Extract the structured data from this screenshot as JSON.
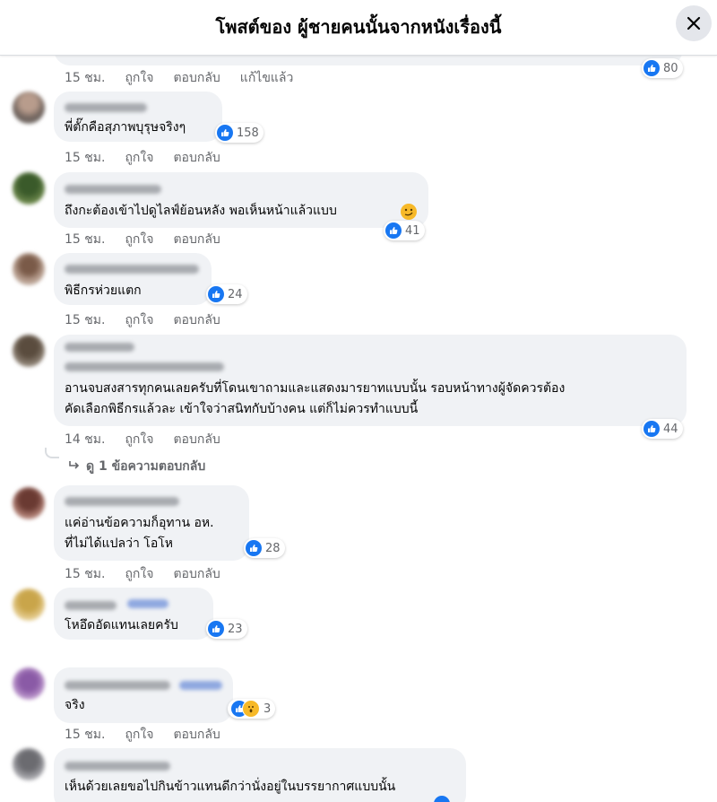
{
  "header": {
    "title": "โพสต์ของ ผู้ชายคนนั้นจากหนังเรื่องนี้"
  },
  "actions": {
    "time_15": "15 ชม.",
    "time_14": "14 ชม.",
    "like": "ถูกใจ",
    "reply": "ตอบกลับ",
    "edited": "แก้ไขแล้ว"
  },
  "comments": [
    {
      "reactions": "80"
    },
    {
      "text": "พี่ตั๊กคือสุภาพบุรุษจริงๆ",
      "reactions": "158"
    },
    {
      "text": "ถึงกะต้องเข้าไปดูไลฟ์ย้อนหลัง พอเห็นหน้าแล้วแบบ",
      "reactions": "41"
    },
    {
      "text": "พิธีกรห่วยแตก",
      "reactions": "24"
    },
    {
      "line1": "อานจบสงสารทุกคนเลยครับที่โดนเขาถามและแสดงมารยาทแบบนั้น รอบหน้าทางผู้จัดควรต้อง",
      "line2": "คัดเลือกพิธีกรแล้วละ เข้าใจว่าสนิทกับบ้างคน แต่ก็ไม่ควรทำแบบนี้",
      "reactions": "44",
      "view_replies": "ดู 1 ข้อความตอบกลับ"
    },
    {
      "line1": "แค่อ่านข้อความก็อุทาน อห.",
      "line2": "ที่ไม่ได้แปลว่า โอโห",
      "reactions": "28"
    },
    {
      "text": "โหอึดอัดแทนเลยครับ",
      "reactions": "23"
    },
    {
      "text": "จริง",
      "reactions": "3"
    },
    {
      "text": "เห็นด้วยเลยขอไปกินข้าวแทนดีกว่านั่งอยู่ในบรรยากาศแบบนั้น"
    }
  ],
  "icons": {
    "close": "close-icon",
    "like": "like-reaction-icon",
    "wow": "wow-reaction-icon",
    "reply_arrow": "reply-arrow-icon"
  },
  "colors": {
    "accent": "#1877f2",
    "bubble": "#f0f2f5",
    "muted": "#65676b"
  }
}
